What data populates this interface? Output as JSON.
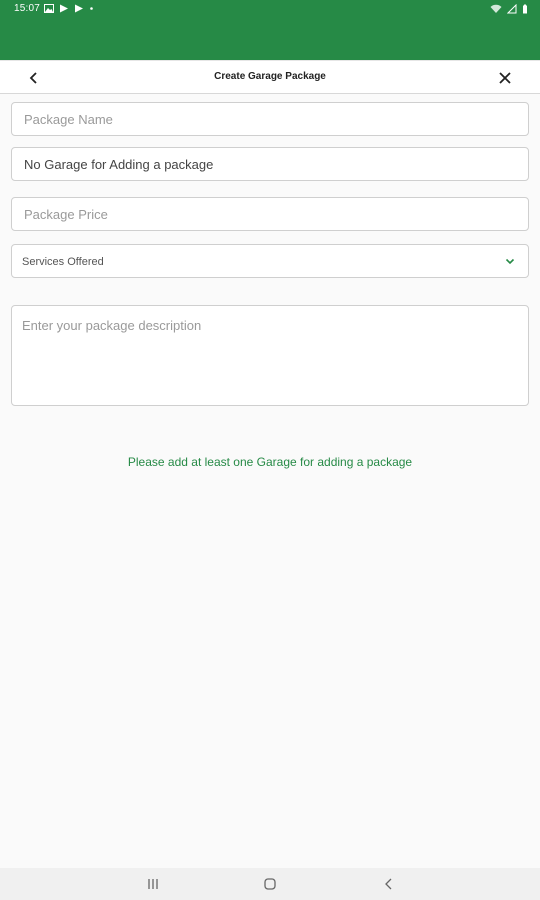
{
  "status_bar": {
    "time": "15:07",
    "background": "#268a46"
  },
  "app_bar": {
    "title": "Create Garage Package"
  },
  "form": {
    "package_name": {
      "value": "",
      "placeholder": "Package Name"
    },
    "garage": {
      "value": "No Garage for Adding a package",
      "placeholder": ""
    },
    "package_price": {
      "value": "",
      "placeholder": "Package Price"
    },
    "services": {
      "selected": "Services Offered"
    },
    "description": {
      "value": "",
      "placeholder": "Enter your package description"
    }
  },
  "notice": {
    "text": "Please add at least one Garage for adding a package",
    "color": "#268a46"
  },
  "icons": {
    "back": "chevron-left-icon",
    "close": "close-icon",
    "dropdown": "chevron-down-icon",
    "nav_recent": "recent-apps-icon",
    "nav_home": "home-icon",
    "nav_back": "back-icon"
  }
}
